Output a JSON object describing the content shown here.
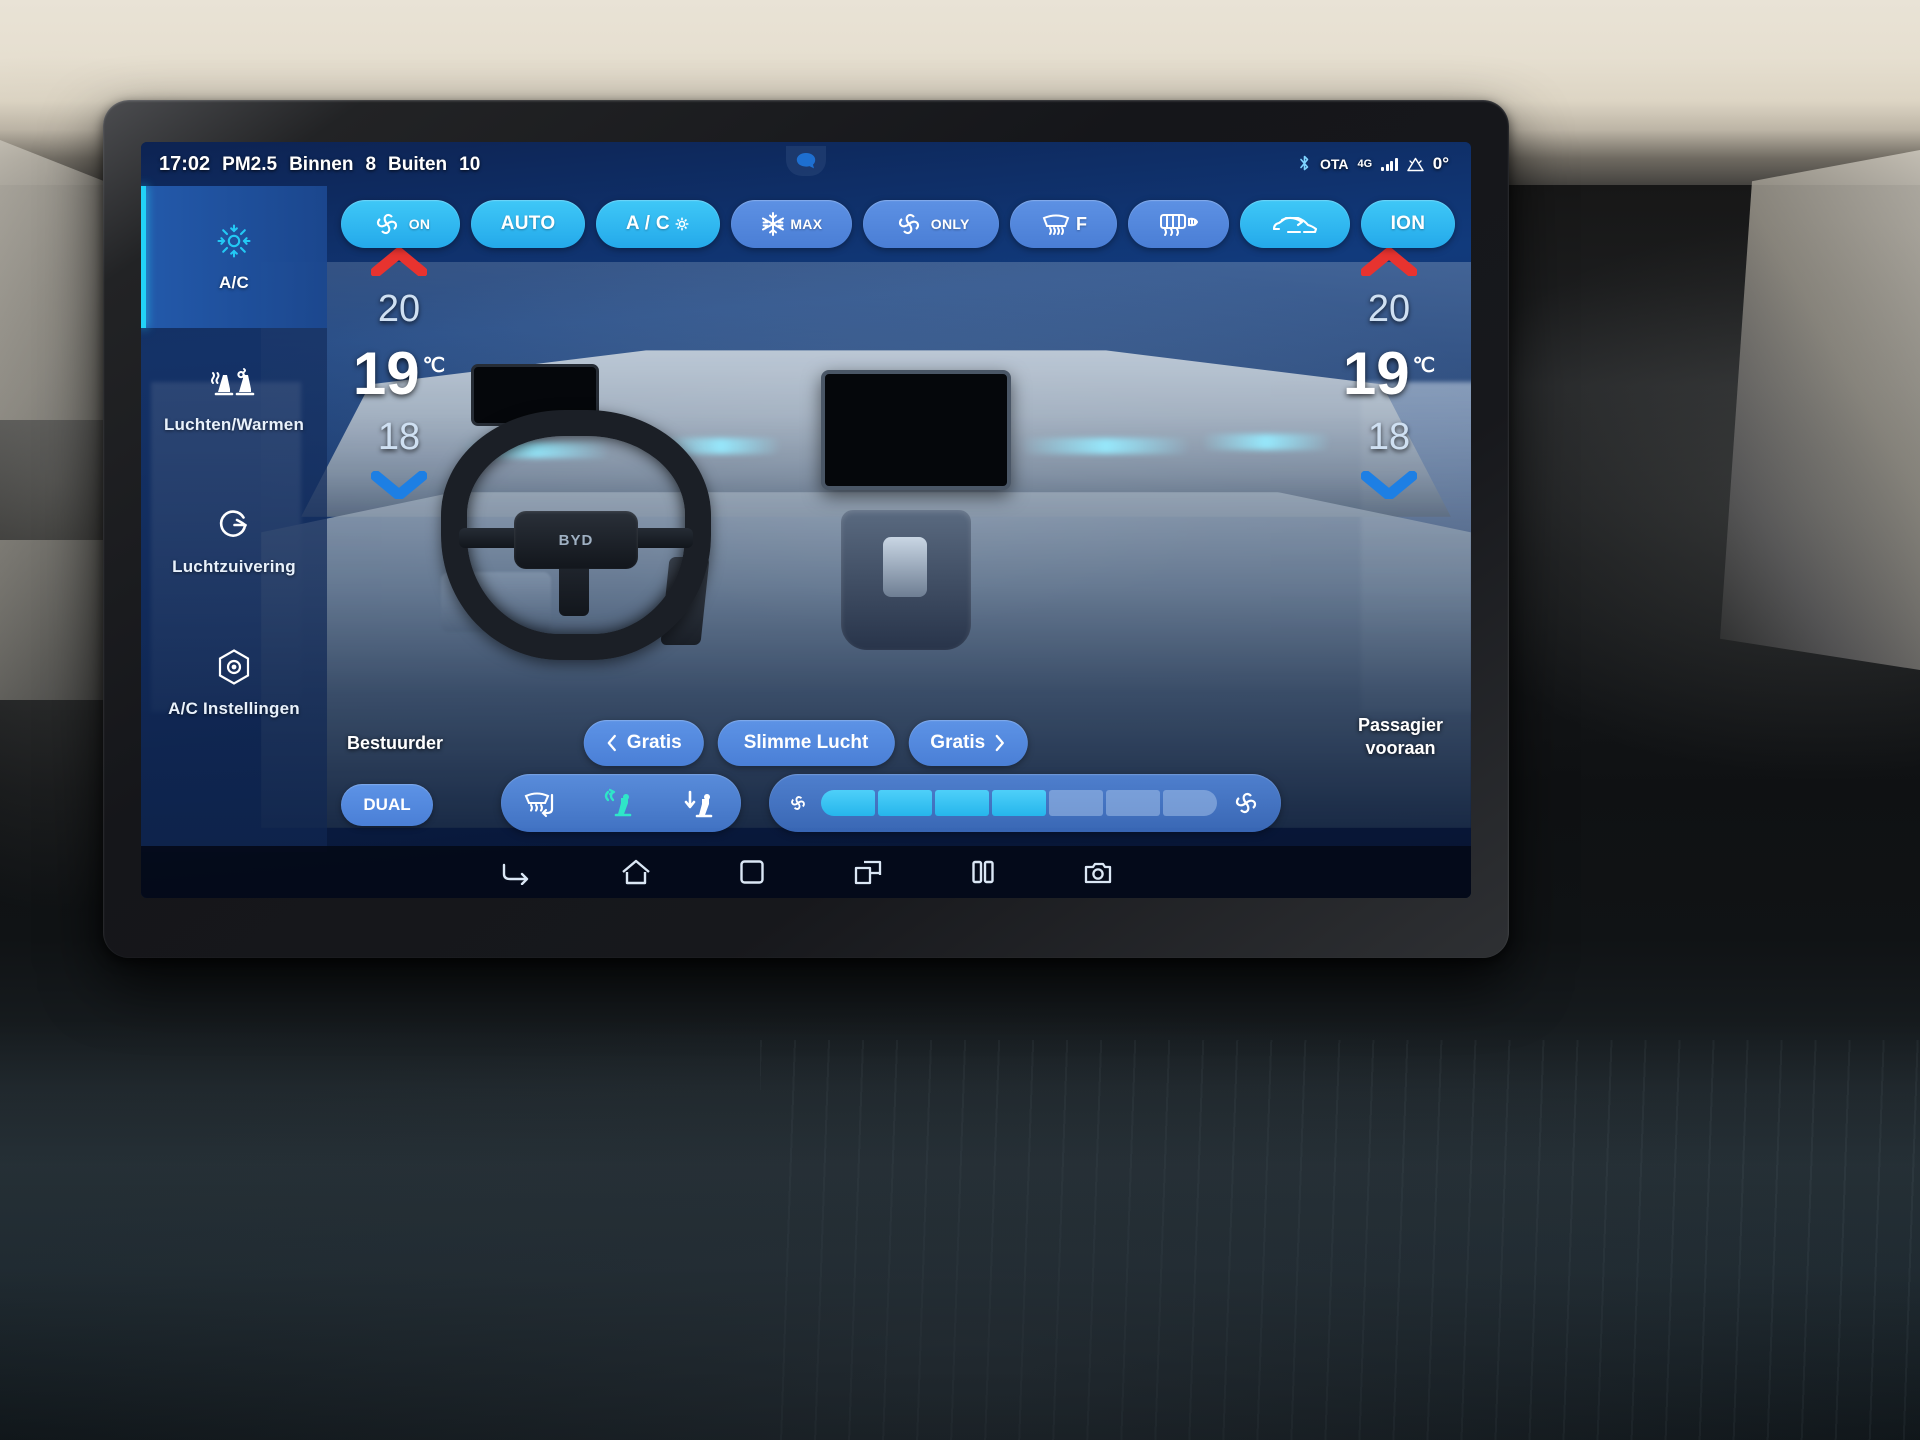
{
  "device": {
    "type": "car-infotainment-touchscreen",
    "app": "Climate Control"
  },
  "statusbar": {
    "time": "17:02",
    "pm_label": "PM2.5",
    "inside_label": "Binnen",
    "inside_value": "8",
    "outside_label": "Buiten",
    "outside_value": "10",
    "bluetooth_icon": "bluetooth-icon",
    "ota_label": "OTA",
    "network_label": "4G",
    "signal_icon": "signal-bars-icon",
    "warning_icon": "warning-triangle-icon",
    "exterior_temp": "0°",
    "mic_icon": "voice-assistant-icon"
  },
  "sidebar": {
    "items": [
      {
        "label": "A/C",
        "icon": "snowflake-sun-icon",
        "active": true
      },
      {
        "label": "Luchten/Warmen",
        "icon": "seat-heat-vent-icon",
        "active": false
      },
      {
        "label": "Luchtzuivering",
        "icon": "air-purify-icon",
        "active": false
      },
      {
        "label": "A/C Instellingen",
        "icon": "settings-hex-icon",
        "active": false
      }
    ]
  },
  "quick_buttons": [
    {
      "label": "ON",
      "icon": "fan-icon",
      "state": "on",
      "style": "active"
    },
    {
      "label": "AUTO",
      "icon": "",
      "state": "on",
      "style": "active"
    },
    {
      "label": "A / C",
      "icon": "ac-gear-icon",
      "state": "on",
      "style": "active"
    },
    {
      "label": "MAX",
      "icon": "snowflake-icon",
      "state": "off",
      "style": "inactive"
    },
    {
      "label": "ONLY",
      "icon": "fan-icon",
      "state": "off",
      "style": "inactive"
    },
    {
      "label": "F",
      "icon": "front-defrost-icon",
      "state": "off",
      "style": "inactive"
    },
    {
      "label": "",
      "icon": "rear-defrost-icon",
      "state": "off",
      "style": "inactive"
    },
    {
      "label": "",
      "icon": "recirculate-car-icon",
      "state": "on",
      "style": "active"
    },
    {
      "label": "ION",
      "icon": "",
      "state": "on",
      "style": "active"
    }
  ],
  "climate": {
    "driver": {
      "zone_label": "Bestuurder",
      "temp_above": "20",
      "temp_current": "19",
      "temp_below": "18",
      "unit": "℃",
      "up_icon": "chevron-up-icon",
      "down_icon": "chevron-down-icon"
    },
    "passenger": {
      "zone_label_line1": "Passagier",
      "zone_label_line2": "vooraan",
      "temp_above": "20",
      "temp_current": "19",
      "temp_below": "18",
      "unit": "℃",
      "up_icon": "chevron-up-icon",
      "down_icon": "chevron-down-icon"
    }
  },
  "mid_buttons": {
    "prev_label": "Gratis",
    "center_label": "Slimme Lucht",
    "next_label": "Gratis",
    "prev_icon": "chevron-left-icon",
    "next_icon": "chevron-right-icon"
  },
  "bottom": {
    "dual_label": "DUAL",
    "airflow_modes": [
      {
        "icon": "defrost-windshield-icon",
        "name": "mode-defrost",
        "active": false
      },
      {
        "icon": "face-vent-icon",
        "name": "mode-face",
        "active": true
      },
      {
        "icon": "foot-vent-icon",
        "name": "mode-foot",
        "active": false
      }
    ],
    "fan": {
      "icon_left": "fan-small-icon",
      "icon_right": "fan-large-icon",
      "segments_total": 7,
      "segments_filled": 4,
      "level": 4
    }
  },
  "navbar": {
    "items": [
      {
        "name": "back-button",
        "icon": "back-arrow-icon"
      },
      {
        "name": "home-button",
        "icon": "home-icon"
      },
      {
        "name": "recents-button",
        "icon": "square-icon"
      },
      {
        "name": "split-screen-button",
        "icon": "split-screen-icon"
      },
      {
        "name": "pause-button",
        "icon": "pause-icon"
      },
      {
        "name": "screenshot-button",
        "icon": "screenshot-camera-icon"
      }
    ]
  },
  "colors": {
    "accent_cyan": "#3fc8f7",
    "button_blue": "#5d93e6",
    "sidebar_active": "#245caf",
    "screen_bg": "#0d2352",
    "warm_arrow": "#e03131",
    "cool_arrow": "#1f7fe0"
  },
  "cabin_render": {
    "brand_badge": "BYD"
  }
}
